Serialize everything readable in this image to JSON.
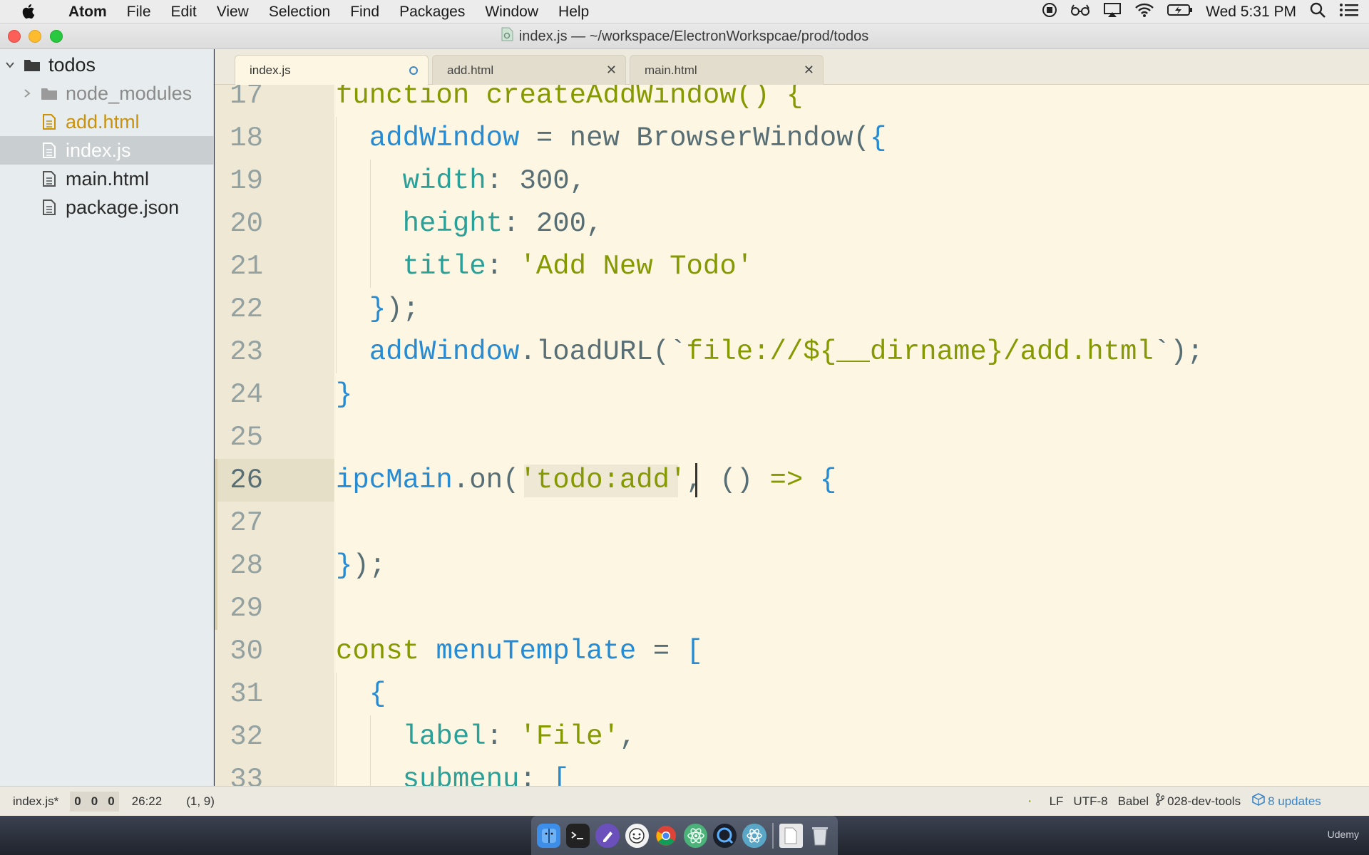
{
  "menubar": {
    "app_name": "Atom",
    "items": [
      "File",
      "Edit",
      "View",
      "Selection",
      "Find",
      "Packages",
      "Window",
      "Help"
    ],
    "clock": "Wed 5:31 PM"
  },
  "window": {
    "title": "index.js — ~/workspace/ElectronWorkspcae/prod/todos"
  },
  "tree": {
    "root": "todos",
    "items": [
      {
        "label": "node_modules",
        "type": "folder",
        "state": "collapsed"
      },
      {
        "label": "add.html",
        "type": "file",
        "state": "modified"
      },
      {
        "label": "index.js",
        "type": "file",
        "state": "selected"
      },
      {
        "label": "main.html",
        "type": "file",
        "state": "normal"
      },
      {
        "label": "package.json",
        "type": "file",
        "state": "normal"
      }
    ]
  },
  "tabs": [
    {
      "label": "index.js",
      "active": true,
      "modified": true
    },
    {
      "label": "add.html",
      "active": false,
      "modified": false
    },
    {
      "label": "main.html",
      "active": false,
      "modified": false
    }
  ],
  "editor": {
    "cursor_line": "26",
    "lines": [
      {
        "n": "17",
        "tokens": [
          {
            "t": "function createAddWindow() {",
            "c": "keyword"
          }
        ]
      },
      {
        "n": "18",
        "tokens": [
          {
            "t": "  "
          },
          {
            "t": "addWindow",
            "c": "var"
          },
          {
            "t": " = "
          },
          {
            "t": "new BrowserWindow(",
            "c": "plain"
          },
          {
            "t": "{",
            "c": "brace"
          }
        ]
      },
      {
        "n": "19",
        "tokens": [
          {
            "t": "    "
          },
          {
            "t": "width",
            "c": "prop"
          },
          {
            "t": ": "
          },
          {
            "t": "300",
            "c": "plain"
          },
          {
            "t": ","
          }
        ]
      },
      {
        "n": "20",
        "tokens": [
          {
            "t": "    "
          },
          {
            "t": "height",
            "c": "prop"
          },
          {
            "t": ": "
          },
          {
            "t": "200",
            "c": "plain"
          },
          {
            "t": ","
          }
        ]
      },
      {
        "n": "21",
        "tokens": [
          {
            "t": "    "
          },
          {
            "t": "title",
            "c": "prop"
          },
          {
            "t": ": "
          },
          {
            "t": "'Add New Todo'",
            "c": "string"
          }
        ]
      },
      {
        "n": "22",
        "tokens": [
          {
            "t": "  "
          },
          {
            "t": "}",
            "c": "brace"
          },
          {
            "t": ");"
          }
        ]
      },
      {
        "n": "23",
        "tokens": [
          {
            "t": "  "
          },
          {
            "t": "addWindow",
            "c": "var"
          },
          {
            "t": "."
          },
          {
            "t": "loadURL(`",
            "c": "plain"
          },
          {
            "t": "file://${",
            "c": "string"
          },
          {
            "t": "__dirname",
            "c": "string"
          },
          {
            "t": "}/add.html",
            "c": "string"
          },
          {
            "t": "`);"
          }
        ]
      },
      {
        "n": "24",
        "tokens": [
          {
            "t": "}",
            "c": "brace"
          }
        ]
      },
      {
        "n": "25",
        "tokens": []
      },
      {
        "n": "26",
        "tokens": [
          {
            "t": "ipcMain",
            "c": "var"
          },
          {
            "t": ".on("
          },
          {
            "t": "'todo:add'",
            "c": "string"
          },
          {
            "t": ", () "
          },
          {
            "t": "=>",
            "c": "keyword"
          },
          {
            "t": " "
          },
          {
            "t": "{",
            "c": "brace"
          }
        ]
      },
      {
        "n": "27",
        "tokens": []
      },
      {
        "n": "28",
        "tokens": [
          {
            "t": "}",
            "c": "brace"
          },
          {
            "t": ");"
          }
        ]
      },
      {
        "n": "29",
        "tokens": []
      },
      {
        "n": "30",
        "tokens": [
          {
            "t": "const",
            "c": "keyword"
          },
          {
            "t": " "
          },
          {
            "t": "menuTemplate",
            "c": "var"
          },
          {
            "t": " = "
          },
          {
            "t": "[",
            "c": "brace"
          }
        ]
      },
      {
        "n": "31",
        "tokens": [
          {
            "t": "  "
          },
          {
            "t": "{",
            "c": "brace"
          }
        ]
      },
      {
        "n": "32",
        "tokens": [
          {
            "t": "    "
          },
          {
            "t": "label",
            "c": "prop"
          },
          {
            "t": ": "
          },
          {
            "t": "'File'",
            "c": "string"
          },
          {
            "t": ","
          }
        ]
      },
      {
        "n": "33",
        "tokens": [
          {
            "t": "    "
          },
          {
            "t": "submenu",
            "c": "prop"
          },
          {
            "t": ": "
          },
          {
            "t": "[",
            "c": "brace"
          }
        ]
      }
    ]
  },
  "statusbar": {
    "file": "index.js*",
    "lint_counts": [
      "0",
      "0",
      "0"
    ],
    "cursor_position": "26:22",
    "selection": "(1, 9)",
    "line_ending": "LF",
    "encoding": "UTF-8",
    "grammar": "Babel",
    "branch": "028-dev-tools",
    "updates": "8 updates"
  },
  "watermark": "Udemy",
  "colors": {
    "keyword": "#859900",
    "var": "#268bd2",
    "prop": "#2aa198",
    "string": "#2aa198",
    "string_literal": "#859900",
    "brace": "#268bd2",
    "plain": "#586e75",
    "tree_modified": "#c9920a",
    "tree_dim": "#8a8a8a",
    "accent_blue": "#3a86c8"
  }
}
